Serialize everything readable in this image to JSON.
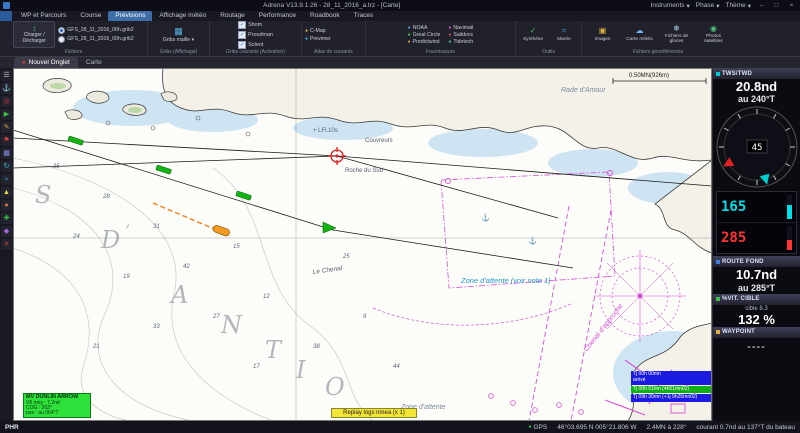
{
  "title_bar": {
    "title": "Adrena V13.9.1.26 - 28_11_2016_a.trz - [Carte]",
    "items": [
      "Instruments",
      "Phase",
      "Thème"
    ],
    "window_buttons": [
      "–",
      "□",
      "×"
    ]
  },
  "menu": {
    "tabs": [
      "WP et Parcours",
      "Course",
      "Prévisions",
      "Affichage météo",
      "Routage",
      "Performance",
      "Roadbook",
      "Traces"
    ],
    "active": "Prévisions"
  },
  "ribbon": {
    "load_button": {
      "line1": "Charger /",
      "line2": "Décharger"
    },
    "grib_files": [
      {
        "label": "GFS_28_11_2016_06h.grib2"
      },
      {
        "label": "GFS_28_11_2016_00h.grib2"
      }
    ],
    "gribs_maille": "Gribs maille",
    "current_checkboxes": [
      "Shom",
      "Proudman",
      "Solent"
    ],
    "atlas_items": [
      "C-Map",
      "Previmer"
    ],
    "providers": [
      "NOAA",
      "Great Circle",
      "Predictwind",
      "Navimail",
      "Saildocs",
      "Tidetech"
    ],
    "tools_items": [
      "Synthèse",
      "Marée"
    ],
    "geo_items": [
      "Images",
      "Carte météo",
      "Fichiers de glaces",
      "Photos satellites"
    ],
    "group_labels": [
      "Fichiers",
      "Gribs (Affichage)",
      "Gribs courants (Activation)",
      "Atlas de courants",
      "Fournisseurs",
      "Outils",
      "Fichiers géoréférencés"
    ]
  },
  "tab_bar": {
    "tabs": [
      "Nouvel Onglet",
      "Carte"
    ]
  },
  "sidebar": {
    "icons": [
      {
        "name": "menu-icon",
        "glyph": "☰"
      },
      {
        "name": "anchor-icon",
        "glyph": "⚓"
      },
      {
        "name": "target-icon",
        "glyph": "◎"
      },
      {
        "name": "route-icon",
        "glyph": "▶"
      },
      {
        "name": "edit-icon",
        "glyph": "✎"
      },
      {
        "name": "flag-icon",
        "glyph": "⚑"
      },
      {
        "name": "grid-icon",
        "glyph": "▦"
      },
      {
        "name": "refresh-icon",
        "glyph": "↻"
      },
      {
        "name": "wind-icon",
        "glyph": "≈"
      },
      {
        "name": "sail-icon",
        "glyph": "▲"
      },
      {
        "name": "buoy-icon",
        "glyph": "●"
      },
      {
        "name": "add-icon",
        "glyph": "✚"
      },
      {
        "name": "layers-icon",
        "glyph": "◆"
      },
      {
        "name": "close-icon",
        "glyph": "✕"
      }
    ]
  },
  "instruments": {
    "tws": {
      "header": "TWS/TWD",
      "value": "20.8nd",
      "direction": "au 240°T"
    },
    "compass": {
      "center": "45"
    },
    "cluster": {
      "top": "165",
      "bottom": "285"
    },
    "route": {
      "header": "ROUTE FOND",
      "value": "10.7nd",
      "direction": "au 285°T"
    },
    "target": {
      "header": "%VIT. CIBLE",
      "cible": "cible  8.3",
      "percent": "132 %"
    },
    "waypoint": {
      "header": "WAYPOINT",
      "value": "----"
    }
  },
  "chart": {
    "scale": "0.50MN(926m)",
    "big_letters": [
      "S",
      "D",
      "’",
      "A",
      "N",
      "T",
      "I",
      "O"
    ],
    "labels": [
      "Rade d'Amour",
      "Roche du Sud",
      "Couvreurs",
      "+ LFl.10s",
      "Le Chenal",
      "Zone d'attente (voir note 1)",
      "Chenal d'approche",
      "Zone d'attente"
    ],
    "soundings": [
      "35",
      "28",
      "31",
      "24",
      "19",
      "42",
      "15",
      "12",
      "27",
      "33",
      "21",
      "17",
      "38",
      "9",
      "44",
      "25"
    ],
    "boat_box": {
      "title": "MV DUNLIN ARROW",
      "lines": [
        "V8 moy : 7.2nd",
        "COG : 262°",
        "pos : au 064°T"
      ]
    },
    "replay_box": "Replay logs nmea (x 1)",
    "eta_boxes": [
      {
        "line1": "Tj 00h 00mn",
        "line2": "arrivé"
      },
      {
        "line1": "Tj 00h 51mn (4h51mn02)"
      },
      {
        "line1": "Tj 09h 30mn (+1j 9h26mn02)"
      }
    ]
  },
  "status_bar": {
    "left": "PHR",
    "gps": "GPS",
    "coords": "46°03.695 N   005°21.806 W",
    "distance": "2.4MN à 228°",
    "current": "courant 0.7nd au 137°T du bateau"
  },
  "icons": {
    "check": "✓",
    "caret": "▾",
    "updown": "↕",
    "grid": "▦",
    "bullet": "●",
    "synthese": "✓",
    "maree": "≈",
    "images": "▣",
    "meteo": "☁",
    "glaces": "❄",
    "photos": "◉",
    "gps_dot": "●"
  }
}
